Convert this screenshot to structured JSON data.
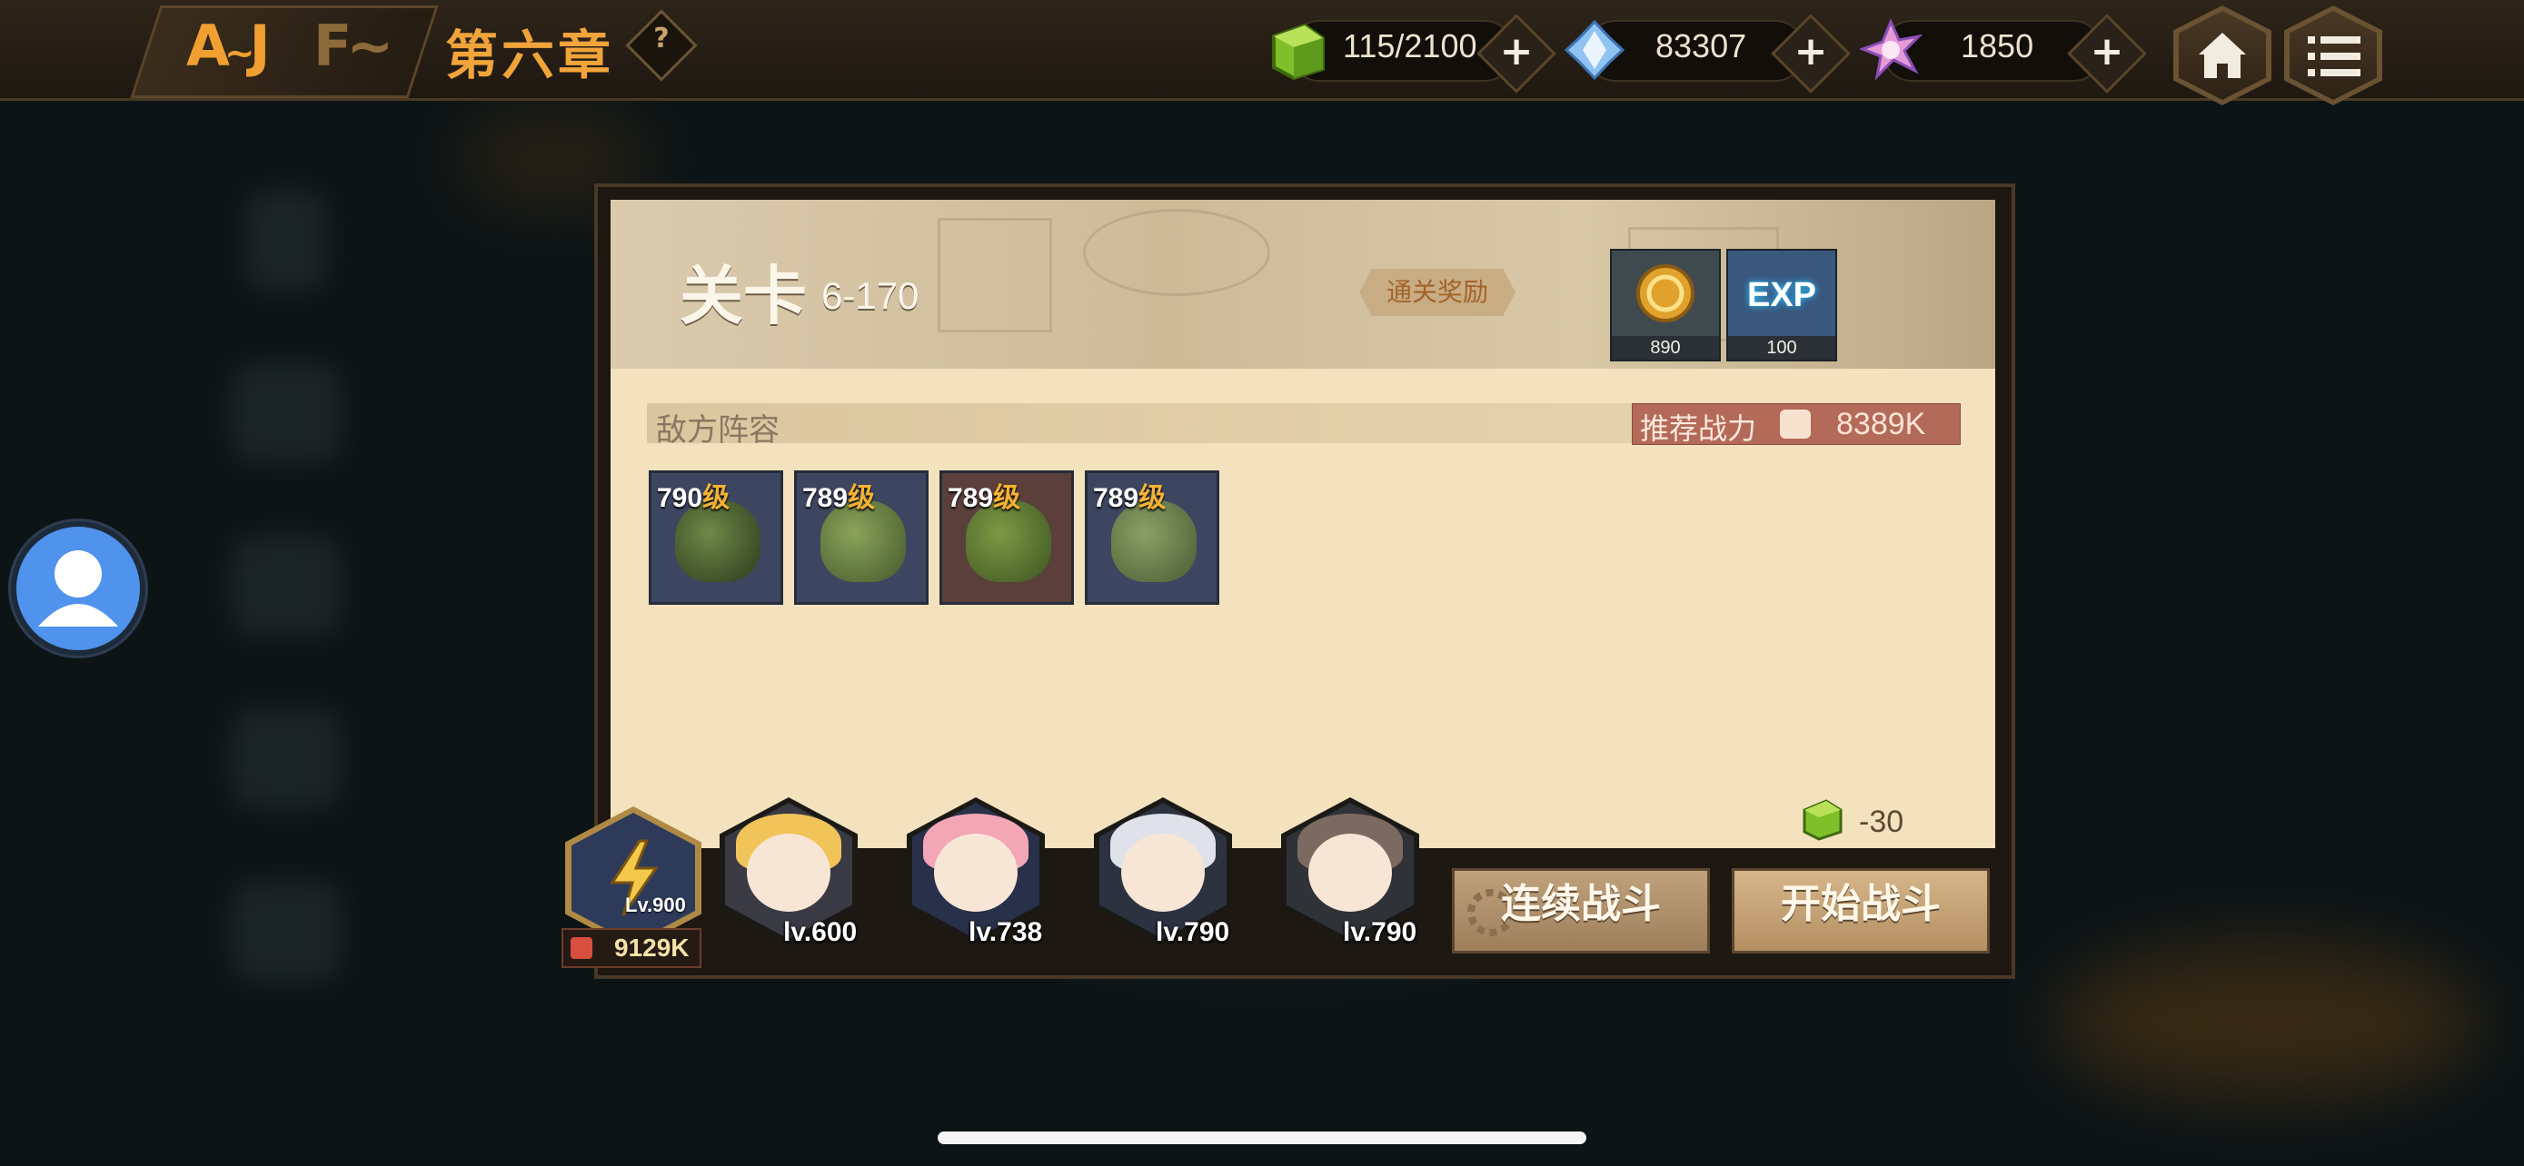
{
  "topbar": {
    "chapter_title": "第六章",
    "help_label": "?",
    "resources": [
      {
        "name": "stamina",
        "icon": "green-cube-icon",
        "value": "115/2100"
      },
      {
        "name": "blue-crystal",
        "icon": "blue-crystal-icon",
        "value": "83307"
      },
      {
        "name": "pink-crystal",
        "icon": "pink-crystal-icon",
        "value": "1850"
      }
    ],
    "plus_label": "+"
  },
  "stage": {
    "label": "关卡",
    "number": "6-170",
    "reward_label": "通关奖励",
    "rewards": [
      {
        "icon": "gold-coin-icon",
        "count": "890"
      },
      {
        "icon": "exp-icon",
        "text": "EXP",
        "count": "100"
      }
    ]
  },
  "enemy_section": {
    "title": "敌方阵容",
    "power_label": "推荐战力",
    "power_value": "8389K",
    "level_unit": "级",
    "enemies": [
      {
        "level": "790"
      },
      {
        "level": "789"
      },
      {
        "level": "789"
      },
      {
        "level": "789"
      }
    ]
  },
  "cost": {
    "value": "-30"
  },
  "team": {
    "leader_level": "Lv.900",
    "total_power": "9129K",
    "heroes": [
      {
        "level": "lv.600"
      },
      {
        "level": "lv.738"
      },
      {
        "level": "lv.790"
      },
      {
        "level": "lv.790"
      }
    ]
  },
  "buttons": {
    "continuous_battle": "连续战斗",
    "start_battle": "开始战斗"
  },
  "colors": {
    "accent_orange": "#f0a43a",
    "panel_cream": "#f3e2bd",
    "power_red": "#b46a58",
    "avatar_blue": "#4f93ec"
  }
}
